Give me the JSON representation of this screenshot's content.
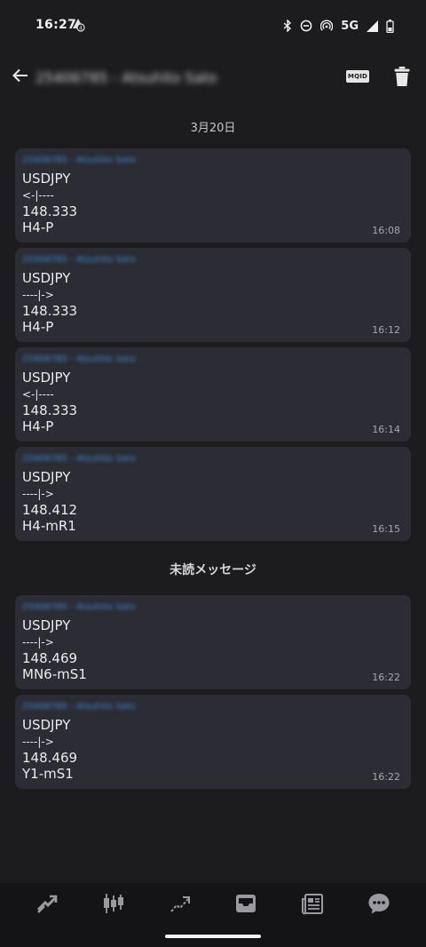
{
  "status_bar": {
    "time": "16:27",
    "network": "5G",
    "icons": [
      "bluetooth-icon",
      "do-not-disturb-icon",
      "hotspot-icon",
      "signal-icon",
      "battery-icon"
    ]
  },
  "app_bar": {
    "title": "25406785 - Atsuhito Sato",
    "mqid_label": "MQID",
    "icons": [
      "back-arrow-icon",
      "trash-icon"
    ]
  },
  "date_divider": "3月20日",
  "unread_divider": "未読メッセージ",
  "messages": [
    {
      "sender": "25406785 - Atsuhito Sato",
      "lines": [
        "USDJPY",
        "<-|----",
        "148.333",
        "H4-P"
      ],
      "time": "16:08"
    },
    {
      "sender": "25406785 - Atsuhito Sato",
      "lines": [
        "USDJPY",
        "----|->",
        "148.333",
        "H4-P"
      ],
      "time": "16:12"
    },
    {
      "sender": "25406785 - Atsuhito Sato",
      "lines": [
        "USDJPY",
        "<-|----",
        "148.333",
        "H4-P"
      ],
      "time": "16:14"
    },
    {
      "sender": "25406785 - Atsuhito Sato",
      "lines": [
        "USDJPY",
        "----|->",
        "148.412",
        "H4-mR1"
      ],
      "time": "16:15"
    },
    {
      "sender": "25406785 - Atsuhito Sato",
      "lines": [
        "USDJPY",
        "----|->",
        "148.469",
        "MN6-mS1"
      ],
      "time": "16:22"
    },
    {
      "sender": "25406785 - Atsuhito Sato",
      "lines": [
        "USDJPY",
        "----|->",
        "148.469",
        "Y1-mS1"
      ],
      "time": "16:22"
    }
  ],
  "bottom_nav": [
    "quotes-icon",
    "chart-icon",
    "trade-icon",
    "history-inbox-icon",
    "news-icon",
    "messages-icon"
  ],
  "colors": {
    "background": "#1c1c1e",
    "bubble": "#2b2c34",
    "sender": "#3e8bd8",
    "nav_bar": "#141416"
  }
}
